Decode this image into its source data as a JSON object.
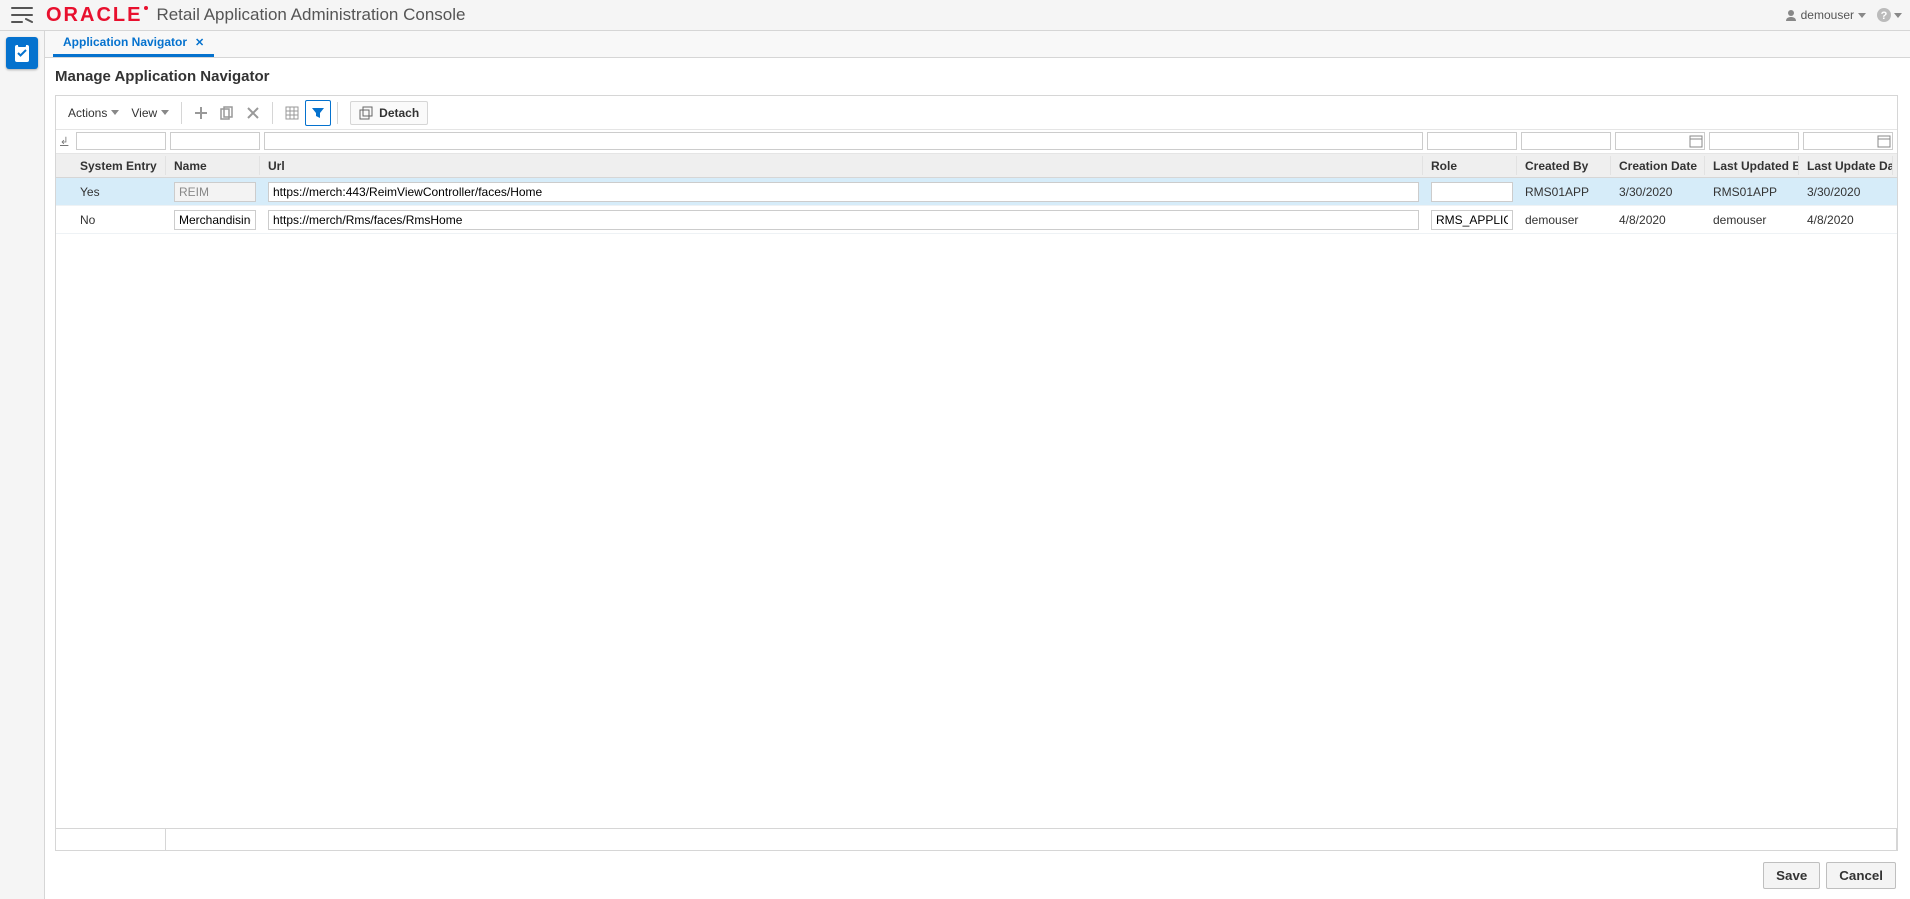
{
  "brand": {
    "logo_text": "ORACLE",
    "app_title": "Retail Application Administration Console"
  },
  "user": {
    "name": "demouser"
  },
  "sidebar": {
    "active_tile_name": "clipboard"
  },
  "tabs": [
    {
      "label": "Application Navigator",
      "closable": true
    }
  ],
  "page_title": "Manage Application Navigator",
  "toolbar": {
    "actions_label": "Actions",
    "view_label": "View",
    "detach_label": "Detach",
    "filter_active": true
  },
  "columns": {
    "system_entry": "System Entry",
    "name": "Name",
    "url": "Url",
    "role": "Role",
    "created_by": "Created By",
    "creation_date": "Creation Date",
    "last_updated_by": "Last Updated By",
    "last_update_date": "Last Update Date"
  },
  "filters": {
    "system_entry": "",
    "name": "",
    "url": "",
    "role": "",
    "created_by": "",
    "creation_date": "",
    "last_updated_by": "",
    "last_update_date": ""
  },
  "rows": [
    {
      "selected": true,
      "system_entry": "Yes",
      "name": "REIM",
      "name_readonly": true,
      "url": "https://merch:443/ReimViewController/faces/Home",
      "role": "",
      "created_by": "RMS01APP",
      "creation_date": "3/30/2020",
      "last_updated_by": "RMS01APP",
      "last_update_date": "3/30/2020"
    },
    {
      "selected": false,
      "system_entry": "No",
      "name": "Merchandising",
      "name_readonly": false,
      "url": "https://merch/Rms/faces/RmsHome",
      "role": "RMS_APPLICATIO",
      "created_by": "demouser",
      "creation_date": "4/8/2020",
      "last_updated_by": "demouser",
      "last_update_date": "4/8/2020"
    }
  ],
  "buttons": {
    "save": "Save",
    "cancel": "Cancel"
  }
}
